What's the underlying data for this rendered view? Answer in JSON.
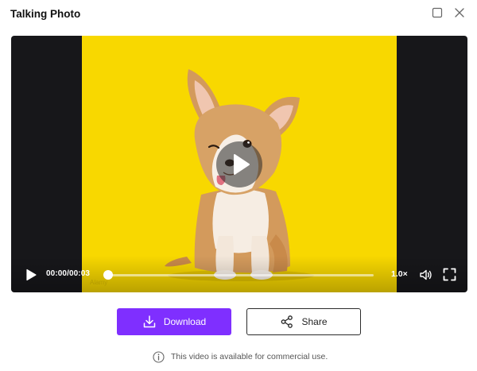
{
  "dialog": {
    "title": "Talking Photo",
    "window_controls": {
      "maximize_icon": "square-icon",
      "close_icon": "close-icon"
    }
  },
  "player": {
    "current_time": "00:00",
    "duration": "00:03",
    "time_display": "00:00/00:03",
    "progress": 0.0,
    "speed": "1.0×",
    "icons": {
      "center": "play-icon",
      "play": "play-icon",
      "volume": "volume-icon",
      "fullscreen": "fullscreen-icon"
    }
  },
  "actions": {
    "download_label": "Download",
    "share_label": "Share"
  },
  "notice": {
    "text": "This video is available for commercial use."
  },
  "colors": {
    "accent": "#7f2fff",
    "video_background": "#f8d800",
    "player_background": "#17171a"
  }
}
